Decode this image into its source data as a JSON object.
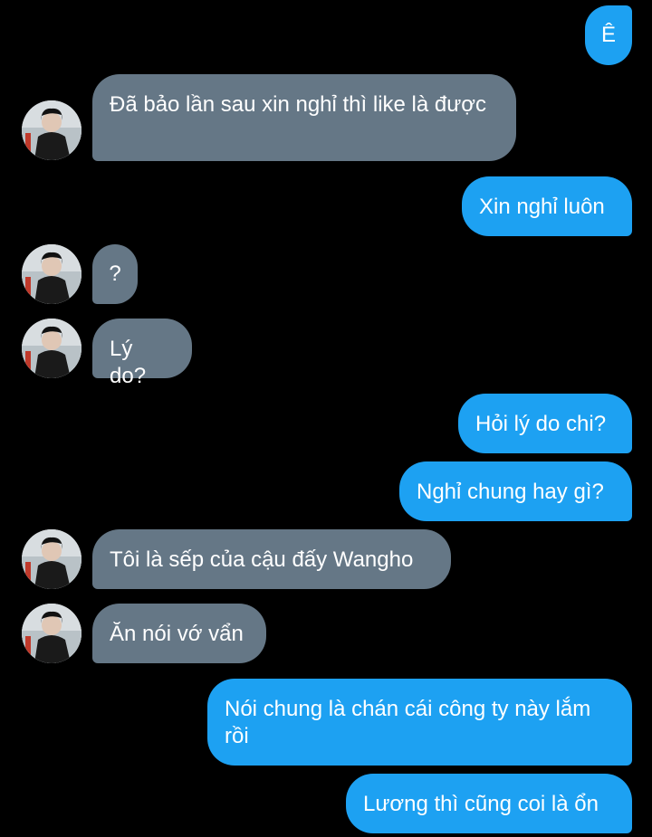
{
  "colors": {
    "background": "#000000",
    "outgoing_bubble": "#1da1f2",
    "incoming_bubble": "#657786",
    "text": "#ffffff"
  },
  "messages": [
    {
      "from": "me",
      "text": "Ê"
    },
    {
      "from": "other",
      "text": "Đã bảo lần sau xin nghỉ thì like là được"
    },
    {
      "from": "me",
      "text": "Xin nghỉ luôn"
    },
    {
      "from": "other",
      "text": "?"
    },
    {
      "from": "other",
      "text": "Lý do?"
    },
    {
      "from": "me",
      "text": "Hỏi lý do chi?"
    },
    {
      "from": "me",
      "text": "Nghỉ chung hay gì?"
    },
    {
      "from": "other",
      "text": "Tôi là sếp của cậu đấy Wangho"
    },
    {
      "from": "other",
      "text": "Ăn nói vớ vẩn"
    },
    {
      "from": "me",
      "text": "Nói chung là chán cái công ty này lắm rồi"
    },
    {
      "from": "me",
      "text": "Lương thì cũng coi là ổn"
    }
  ]
}
